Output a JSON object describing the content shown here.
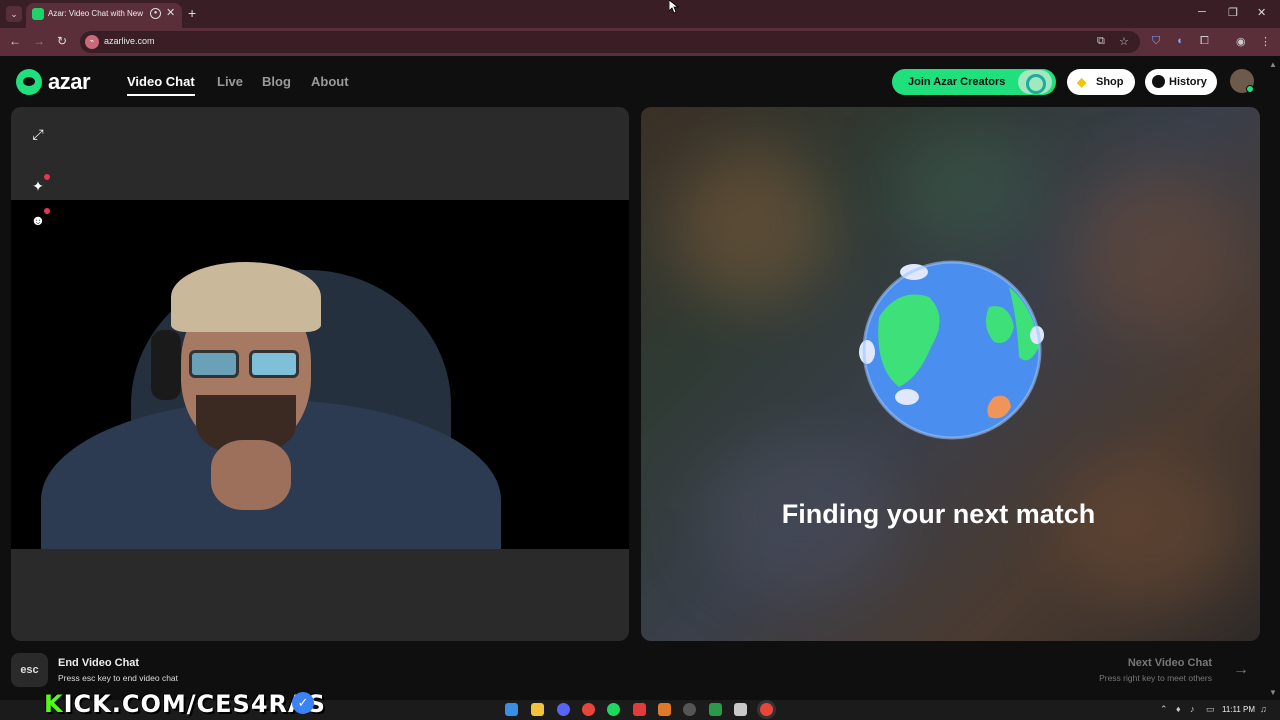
{
  "browser": {
    "tab_title": "Azar: Video Chat with New",
    "url": "azarlive.com"
  },
  "nav": {
    "logo_text": "azar",
    "links": [
      "Video Chat",
      "Live",
      "Blog",
      "About"
    ],
    "active_link": "Video Chat"
  },
  "header": {
    "join_label": "Join Azar Creators",
    "shop_label": "Shop",
    "history_label": "History"
  },
  "match": {
    "status_text": "Finding your next match"
  },
  "footer": {
    "esc_key": "esc",
    "end_title": "End Video Chat",
    "end_sub": "Press esc key to end video chat",
    "next_title": "Next Video Chat",
    "next_sub": "Press right key to meet others"
  },
  "taskbar": {
    "time": "11:11 PM"
  },
  "overlay": {
    "kick_first": "K",
    "kick_rest": "ICK.COM/CES4RAS"
  },
  "colors": {
    "brand": "#1fe07c",
    "tab_bg": "#5a2f3a",
    "page_bg": "#0f0f0f",
    "kick": "#53fc18"
  }
}
